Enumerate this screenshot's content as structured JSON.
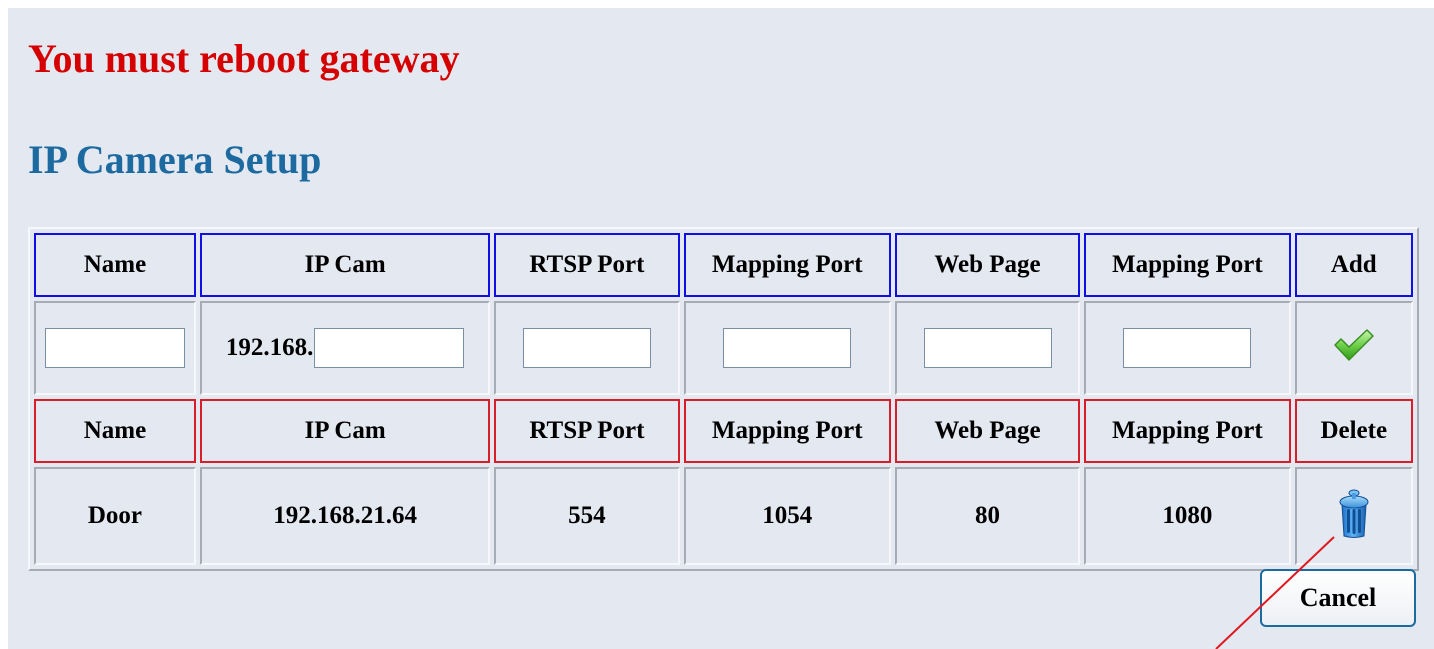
{
  "warning": "You must reboot gateway",
  "title": "IP Camera Setup",
  "add_section": {
    "headers": [
      "Name",
      "IP Cam",
      "RTSP Port",
      "Mapping Port",
      "Web Page",
      "Mapping Port",
      "Add"
    ],
    "ip_prefix": "192.168.",
    "inputs": {
      "name": "",
      "ip_suffix": "",
      "rtsp_port": "",
      "mapping_port": "",
      "web_page": "",
      "web_mapping_port": ""
    },
    "add_icon": "checkmark-icon"
  },
  "list_section": {
    "headers": [
      "Name",
      "IP Cam",
      "RTSP Port",
      "Mapping Port",
      "Web Page",
      "Mapping Port",
      "Delete"
    ],
    "rows": [
      {
        "name": "Door",
        "ip": "192.168.21.64",
        "rtsp_port": "554",
        "mapping_port": "1054",
        "web_page": "80",
        "web_mapping_port": "1080",
        "delete_icon": "trash-can-icon"
      }
    ]
  },
  "cancel_label": "Cancel",
  "colors": {
    "warning": "#d50000",
    "title": "#1c6aa0",
    "add_header_border": "#1010e6",
    "delete_header_border": "#d81e28",
    "panel_background": "#e4e8f0"
  }
}
